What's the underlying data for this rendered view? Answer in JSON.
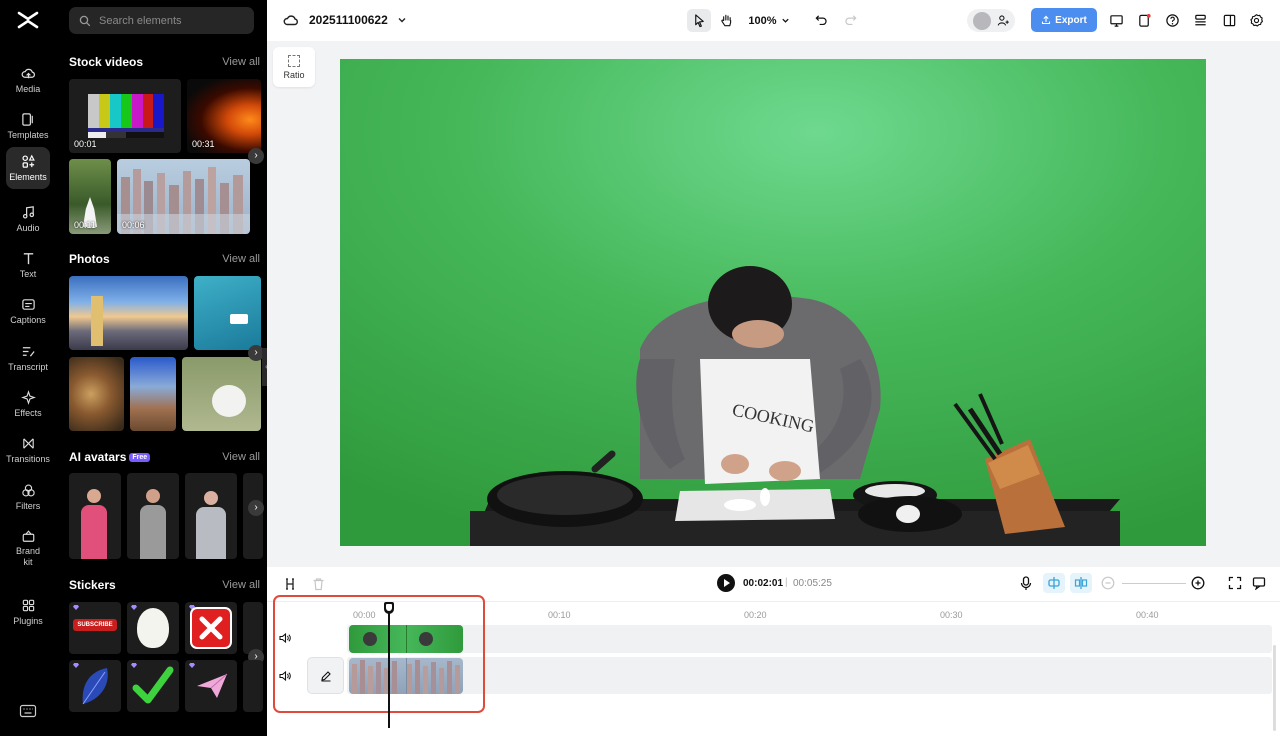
{
  "rail": {
    "items": [
      {
        "label": "Media",
        "icon": "cloud-upload-icon"
      },
      {
        "label": "Templates",
        "icon": "templates-icon"
      },
      {
        "label": "Elements",
        "icon": "elements-icon"
      },
      {
        "label": "Audio",
        "icon": "music-note-icon"
      },
      {
        "label": "Text",
        "icon": "text-icon"
      },
      {
        "label": "Captions",
        "icon": "captions-icon"
      },
      {
        "label": "Transcript",
        "icon": "transcript-icon"
      },
      {
        "label": "Effects",
        "icon": "effects-icon"
      },
      {
        "label": "Transitions",
        "icon": "transitions-icon"
      },
      {
        "label": "Filters",
        "icon": "filters-icon"
      },
      {
        "label": "Brand",
        "label2": "kit",
        "icon": "brand-kit-icon"
      },
      {
        "label": "Plugins",
        "icon": "plugins-icon"
      }
    ],
    "active": "Elements"
  },
  "panel": {
    "search_placeholder": "Search elements",
    "stock_videos": {
      "title": "Stock videos",
      "view_all": "View all",
      "durations": [
        "00:01",
        "00:31",
        "00:11",
        "00:06"
      ]
    },
    "photos": {
      "title": "Photos",
      "view_all": "View all"
    },
    "ai_avatars": {
      "title": "AI avatars",
      "badge": "Free",
      "view_all": "View all"
    },
    "stickers": {
      "title": "Stickers",
      "view_all": "View all",
      "subscribe_text": "SUBSCRIBE"
    }
  },
  "topbar": {
    "project_name": "202511100622",
    "zoom": "100%",
    "export_label": "Export"
  },
  "canvas": {
    "ratio_label": "Ratio"
  },
  "timeline": {
    "current_time": "00:02:01",
    "separator": "|",
    "total_time": "00:05:25",
    "ruler": [
      "00:00",
      "00:10",
      "00:20",
      "00:30",
      "00:40"
    ]
  },
  "colors": {
    "accent": "#4b8ef0",
    "highlight": "#e04a3a",
    "green_screen": "#3fb14f"
  }
}
